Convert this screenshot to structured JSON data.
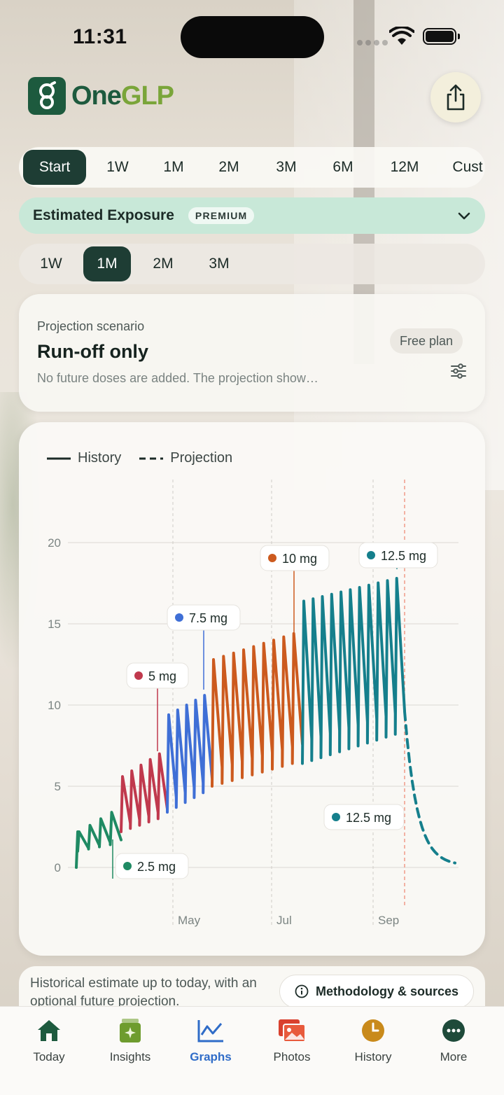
{
  "status": {
    "time": "11:31"
  },
  "brand": {
    "name_part1": "One",
    "name_part2": "GLP"
  },
  "ranges": {
    "tabs": [
      "Start",
      "1W",
      "1M",
      "2M",
      "3M",
      "6M",
      "12M",
      "Cust"
    ],
    "active": "Start"
  },
  "exposure": {
    "title": "Estimated Exposure",
    "badge": "PREMIUM"
  },
  "sub_ranges": {
    "tabs": [
      "1W",
      "1M",
      "2M",
      "3M"
    ],
    "active": "1M"
  },
  "projection": {
    "label": "Projection scenario",
    "title": "Run-off only",
    "description": "No future doses are added. The projection show…",
    "plan_badge": "Free plan"
  },
  "chart_data": {
    "type": "line",
    "legend": [
      "History",
      "Projection"
    ],
    "y_ticks": [
      0,
      5,
      10,
      15,
      20
    ],
    "x_ticks": [
      "May",
      "Jul",
      "Sep"
    ],
    "ylim": [
      0,
      20
    ],
    "series": [
      {
        "name": "2.5 mg",
        "color": "#1f8a63"
      },
      {
        "name": "5 mg",
        "color": "#c0394d"
      },
      {
        "name": "7.5 mg",
        "color": "#3f6fd6"
      },
      {
        "name": "10 mg",
        "color": "#cc5a1e"
      },
      {
        "name": "12.5 mg",
        "color": "#157f8c"
      }
    ],
    "dose_labels": [
      {
        "text": "2.5 mg",
        "color": "#1f8a63"
      },
      {
        "text": "5 mg",
        "color": "#c0394d"
      },
      {
        "text": "7.5 mg",
        "color": "#3f6fd6"
      },
      {
        "text": "10 mg",
        "color": "#cc5a1e"
      },
      {
        "text": "12.5 mg",
        "color": "#157f8c"
      },
      {
        "text": "12.5 mg",
        "color": "#157f8c"
      }
    ]
  },
  "footer": {
    "text": "Historical estimate up to today, with an optional future projection.",
    "method_button": "Methodology & sources"
  },
  "nav": {
    "items": [
      "Today",
      "Insights",
      "Graphs",
      "Photos",
      "History",
      "More"
    ],
    "active": "Graphs"
  }
}
